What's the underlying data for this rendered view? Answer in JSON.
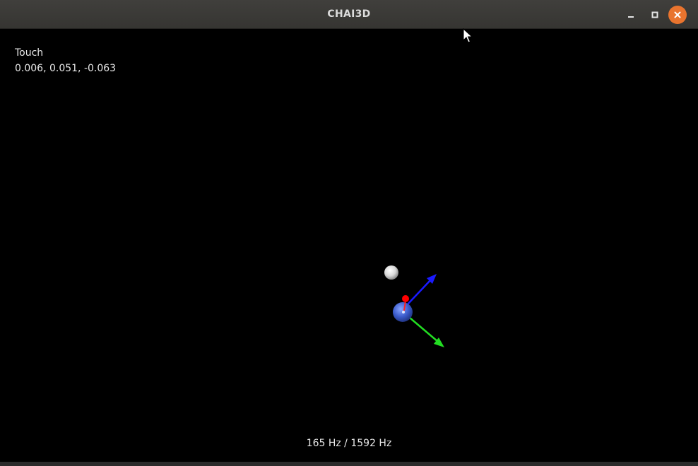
{
  "window": {
    "title": "CHAI3D",
    "controls": {
      "minimize_icon": "minimize-icon",
      "maximize_icon": "maximize-icon",
      "close_icon": "close-icon",
      "close_color": "#e9742e"
    }
  },
  "overlay": {
    "device_name": "Touch",
    "device_position": "0.006, 0.051, -0.063",
    "haptic_rate": "165 Hz / 1592 Hz"
  },
  "scene": {
    "background": "#000000",
    "objects": [
      {
        "name": "target-sphere",
        "color": "#e6e6e6"
      },
      {
        "name": "cursor-sphere",
        "color": "#3a5fcf"
      },
      {
        "name": "x-axis-arrow",
        "color": "#ff0000"
      },
      {
        "name": "y-axis-arrow",
        "color": "#22dd22"
      },
      {
        "name": "z-axis-arrow",
        "color": "#1a1aff"
      }
    ]
  }
}
